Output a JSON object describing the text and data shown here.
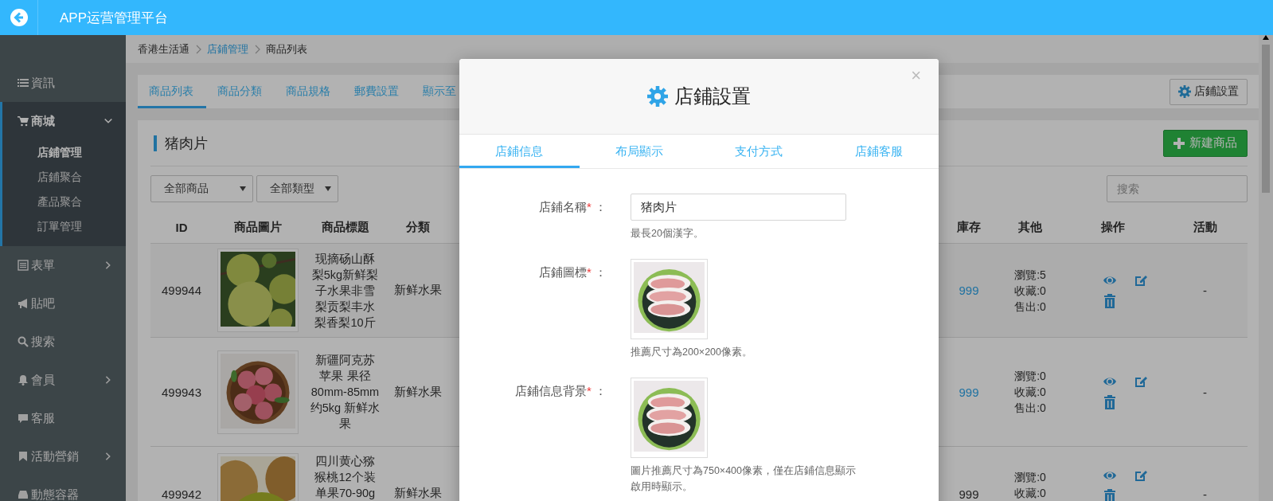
{
  "header": {
    "title": "APP运营管理平台"
  },
  "sidebar": {
    "items": [
      {
        "label": "資訊",
        "kind": "link",
        "selected": false
      },
      {
        "label": "商城",
        "kind": "group",
        "selected": true,
        "expanded": true,
        "children": [
          {
            "label": "店鋪管理",
            "selected": true
          },
          {
            "label": "店鋪聚合",
            "selected": false
          },
          {
            "label": "產品聚合",
            "selected": false
          },
          {
            "label": "訂單管理",
            "selected": false
          }
        ]
      },
      {
        "label": "表單",
        "kind": "group",
        "selected": false,
        "expanded": false
      },
      {
        "label": "貼吧",
        "kind": "link",
        "selected": false
      },
      {
        "label": "搜索",
        "kind": "link",
        "selected": false
      },
      {
        "label": "會員",
        "kind": "group",
        "selected": false,
        "expanded": false
      },
      {
        "label": "客服",
        "kind": "link",
        "selected": false
      },
      {
        "label": "活動營銷",
        "kind": "group",
        "selected": false,
        "expanded": false
      },
      {
        "label": "動態容器",
        "kind": "link",
        "selected": false
      }
    ]
  },
  "breadcrumb": [
    {
      "label": "香港生活通",
      "link": false
    },
    {
      "label": "店鋪管理",
      "link": true
    },
    {
      "label": "商品列表",
      "link": false
    }
  ],
  "tabs": [
    {
      "label": "商品列表",
      "selected": true
    },
    {
      "label": "商品分類",
      "selected": false
    },
    {
      "label": "商品規格",
      "selected": false
    },
    {
      "label": "郵費設置",
      "selected": false
    },
    {
      "label": "顯示至",
      "selected": false
    }
  ],
  "settings_button": {
    "label": "店鋪設置"
  },
  "panel": {
    "title": "猪肉片",
    "new_button": {
      "label": "新建商品"
    },
    "filters": [
      {
        "value": "全部商品"
      },
      {
        "value": "全部類型"
      }
    ],
    "search": {
      "placeholder": "搜索"
    }
  },
  "table": {
    "columns": [
      "ID",
      "商品圖片",
      "商品標題",
      "分類",
      "庫存",
      "其他",
      "操作",
      "活動"
    ],
    "rows": [
      {
        "id": "499944",
        "title": "现摘砀山酥梨5kg新鲜梨子水果非雪梨贡梨丰水梨香梨10斤",
        "category": "新鲜水果",
        "stock": "999",
        "stock_link": true,
        "stats": [
          "瀏覽:5",
          "收藏:0",
          "售出:0"
        ],
        "activity": "-"
      },
      {
        "id": "499943",
        "title": "新疆阿克苏苹果 果径80mm-85mm 约5kg 新鲜水果",
        "category": "新鲜水果",
        "stock": "999",
        "stock_link": true,
        "stats": [
          "瀏覽:0",
          "收藏:0",
          "售出:0"
        ],
        "activity": "-"
      },
      {
        "id": "499942",
        "title": "四川黄心猕猴桃12个装单果70-90g",
        "category": "新鲜水果",
        "stock": "999",
        "stock_link": false,
        "stats": [
          "瀏覽:0",
          "收藏:0"
        ],
        "activity": "-"
      }
    ]
  },
  "modal": {
    "title": "店鋪設置",
    "close": "×",
    "tabs": [
      {
        "label": "店鋪信息",
        "selected": true
      },
      {
        "label": "布局顯示",
        "selected": false
      },
      {
        "label": "支付方式",
        "selected": false
      },
      {
        "label": "店鋪客服",
        "selected": false
      }
    ],
    "fields": [
      {
        "label": "店鋪名稱",
        "required_mark": "*",
        "colon": "：",
        "kind": "text",
        "value": "猪肉片",
        "help": "最長20個漢字。"
      },
      {
        "label": "店鋪圖標",
        "required_mark": "*",
        "colon": "：",
        "help": "推薦尺寸為200×200像素。"
      },
      {
        "label": "店鋪信息背景",
        "required_mark": "*",
        "colon": "：",
        "help": "圖片推薦尺寸為750×400像素，僅在店鋪信息顯示啟用時顯示。"
      }
    ]
  }
}
